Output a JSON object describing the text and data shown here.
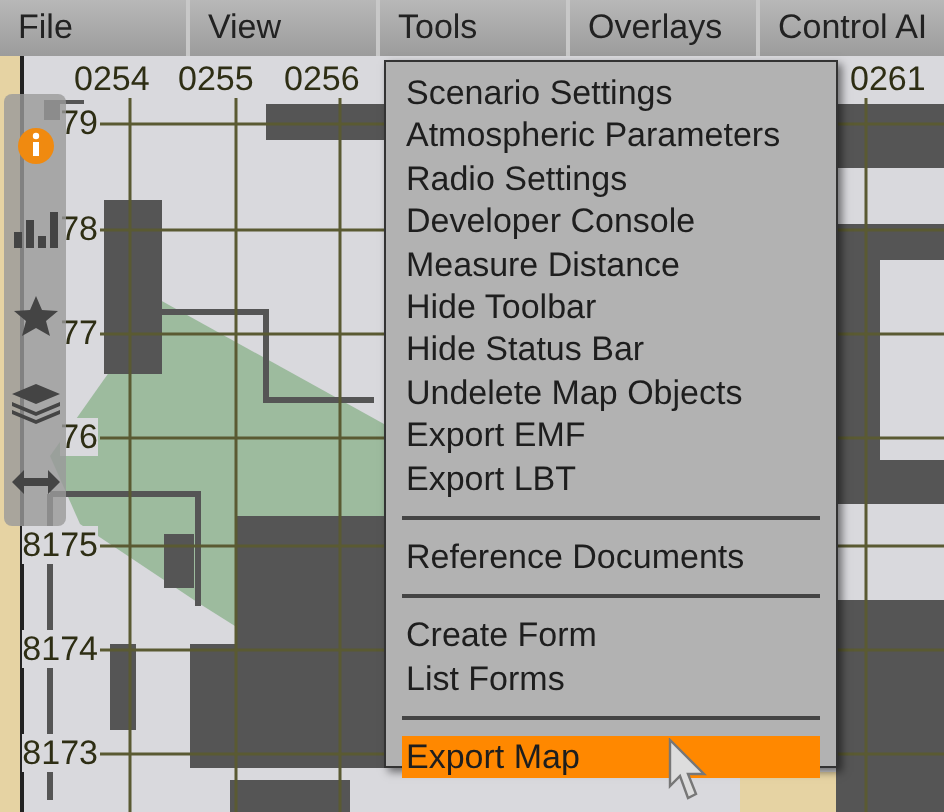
{
  "menu_bar": [
    {
      "label": "File"
    },
    {
      "label": "View"
    },
    {
      "label": "Tools"
    },
    {
      "label": "Overlays"
    },
    {
      "label": "Control AI"
    }
  ],
  "tools_menu": [
    {
      "kind": "item",
      "label": "Scenario Settings",
      "selected": false
    },
    {
      "kind": "item",
      "label": "Atmospheric Parameters",
      "selected": false
    },
    {
      "kind": "item",
      "label": "Radio Settings",
      "selected": false
    },
    {
      "kind": "item",
      "label": "Developer Console",
      "selected": false
    },
    {
      "kind": "item",
      "label": "Measure Distance",
      "selected": false
    },
    {
      "kind": "item",
      "label": "Hide Toolbar",
      "selected": false
    },
    {
      "kind": "item",
      "label": "Hide Status Bar",
      "selected": false
    },
    {
      "kind": "item",
      "label": "Undelete Map Objects",
      "selected": false
    },
    {
      "kind": "item",
      "label": "Export EMF",
      "selected": false
    },
    {
      "kind": "item",
      "label": "Export LBT",
      "selected": false
    },
    {
      "kind": "separator"
    },
    {
      "kind": "item",
      "label": "Reference Documents",
      "selected": false
    },
    {
      "kind": "separator"
    },
    {
      "kind": "item",
      "label": "Create Form",
      "selected": false
    },
    {
      "kind": "item",
      "label": "List Forms",
      "selected": false
    },
    {
      "kind": "separator"
    },
    {
      "kind": "item",
      "label": "Export Map",
      "selected": true
    }
  ],
  "map": {
    "column_labels": [
      {
        "text": "0254"
      },
      {
        "text": "0255"
      },
      {
        "text": "0256"
      },
      {
        "text": "0261"
      }
    ],
    "row_labels": [
      {
        "text": "79"
      },
      {
        "text": "78"
      },
      {
        "text": "77"
      },
      {
        "text": "76"
      },
      {
        "text": "8175"
      },
      {
        "text": "8174"
      },
      {
        "text": "8173"
      }
    ]
  }
}
